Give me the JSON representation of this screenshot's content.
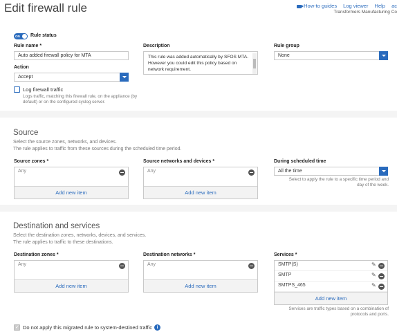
{
  "header": {
    "title": "Edit firewall rule",
    "links": [
      "How-to guides",
      "Log viewer",
      "Help",
      "ac"
    ],
    "company": "Transformers Manufacturing Co"
  },
  "rule": {
    "status_label": "Rule status",
    "toggle_text": "ON",
    "name_label": "Rule name *",
    "name_value": "Auto added firewall policy for MTA",
    "description_label": "Description",
    "description_value": "This rule was added automatically by SFOS MTA. However you could edit this policy based on network requirement.",
    "group_label": "Rule group",
    "group_value": "None",
    "action_label": "Action",
    "action_value": "Accept",
    "log_label": "Log firewall traffic",
    "log_help": "Logs traffic, matching this firewall rule, on the appliance (by default) or on the configured syslog server."
  },
  "source": {
    "title": "Source",
    "desc1": "Select the source zones, networks, and devices.",
    "desc2": "The rule applies to traffic from these sources during the scheduled time period.",
    "zones_label": "Source zones *",
    "zones_items": [
      "Any"
    ],
    "networks_label": "Source networks and devices *",
    "networks_items": [
      "Any"
    ],
    "add_label": "Add new item",
    "schedule_label": "During scheduled time",
    "schedule_value": "All the time",
    "schedule_help": "Select to apply the rule to a specific time period and day of the week."
  },
  "destination": {
    "title": "Destination and services",
    "desc1": "Select the destination zones, networks, devices, and services.",
    "desc2": "The rule applies to traffic to these destinations.",
    "zones_label": "Destination zones *",
    "zones_items": [
      "Any"
    ],
    "networks_label": "Destination networks *",
    "networks_items": [
      "Any"
    ],
    "services_label": "Services *",
    "services_items": [
      "SMTP(S)",
      "SMTP",
      "SMTPS_465"
    ],
    "add_label": "Add new item",
    "services_help": "Services are traffic types based on a combination of protocols and ports."
  },
  "footer": {
    "migrated_label": "Do not apply this migrated rule to system-destined traffic"
  }
}
